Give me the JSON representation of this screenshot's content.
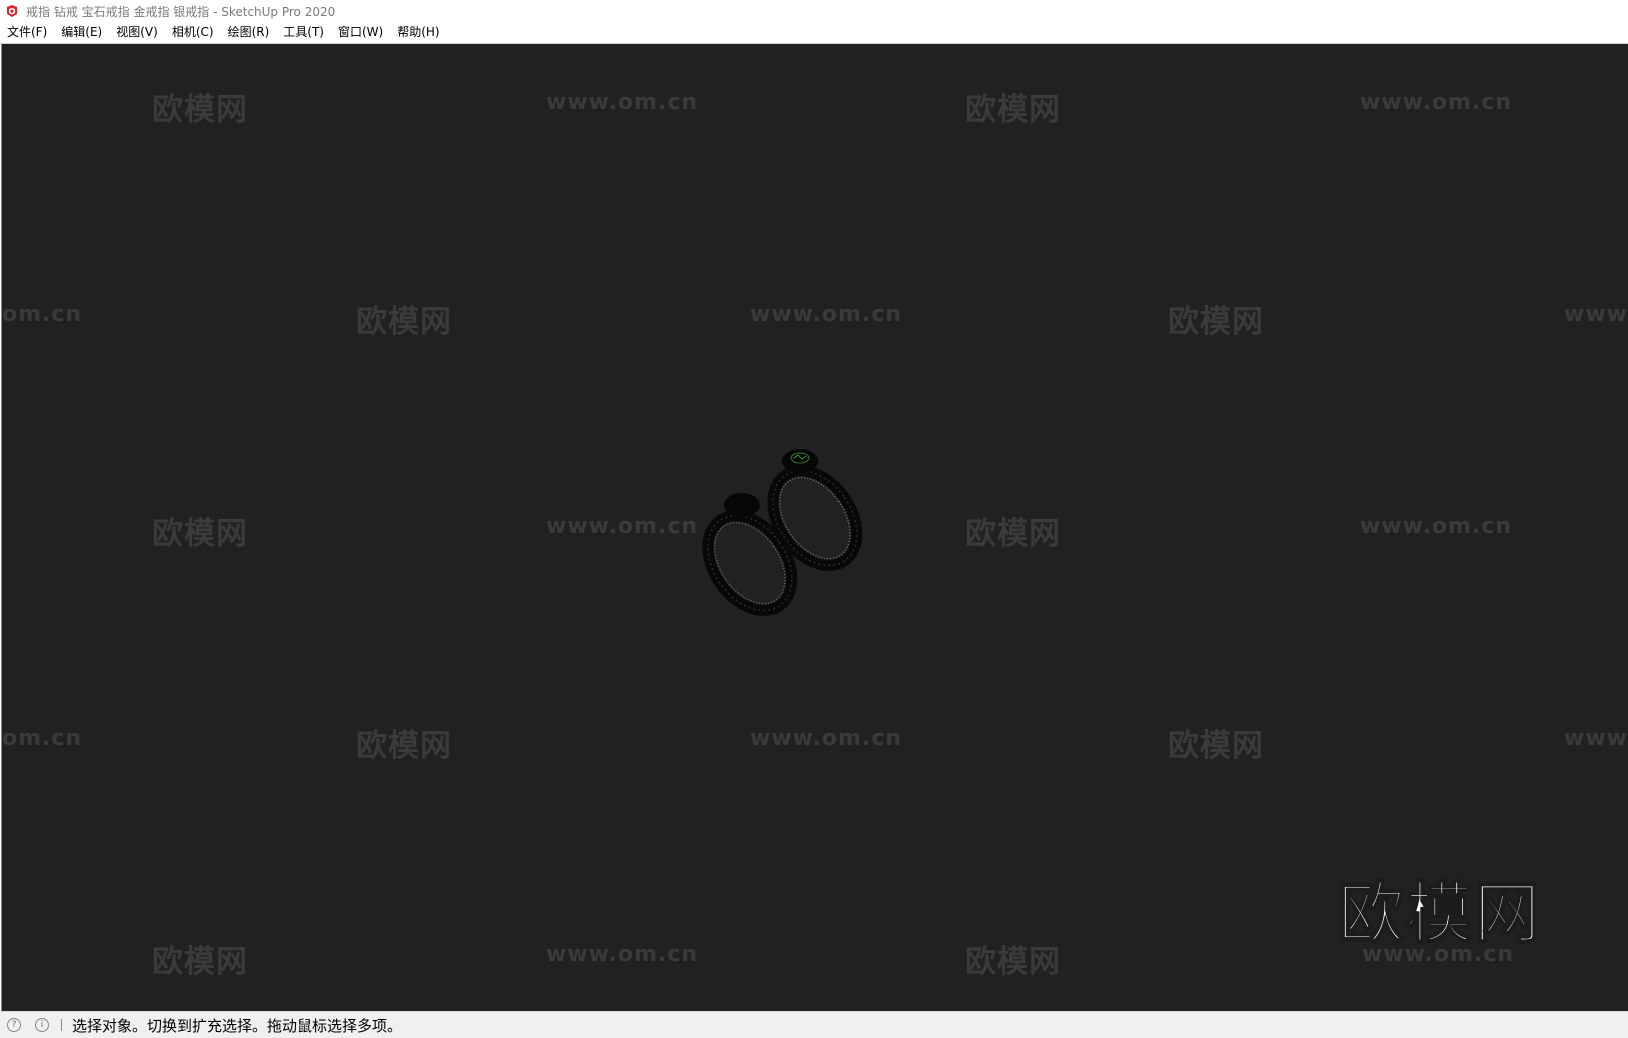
{
  "window": {
    "title": "戒指 钻戒 宝石戒指 金戒指 银戒指 - SketchUp Pro 2020",
    "app_icon": "sketchup-logo-icon"
  },
  "menu": {
    "items": [
      {
        "label": "文件(F)"
      },
      {
        "label": "编辑(E)"
      },
      {
        "label": "视图(V)"
      },
      {
        "label": "相机(C)"
      },
      {
        "label": "绘图(R)"
      },
      {
        "label": "工具(T)"
      },
      {
        "label": "窗口(W)"
      },
      {
        "label": "帮助(H)"
      }
    ]
  },
  "viewport": {
    "background_color": "#212121",
    "watermark_cn": "欧模网",
    "watermark_url": "www.om.cn",
    "watermark_url_partial_left": "om.cn",
    "watermark_url_partial_right": "www.",
    "logo_text": "欧模网",
    "logo_url": "www.om.cn",
    "model": "two-rings"
  },
  "status": {
    "icons": [
      "geo-location-icon",
      "info-icon"
    ],
    "message": "选择对象。切换到扩充选择。拖动鼠标选择多项。"
  }
}
